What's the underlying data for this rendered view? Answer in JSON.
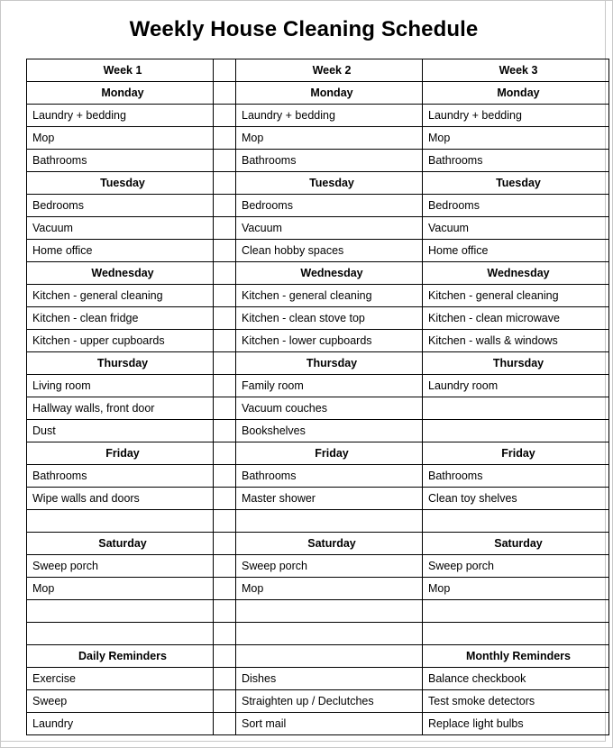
{
  "document": {
    "title": "Weekly House Cleaning Schedule"
  },
  "table": {
    "week_headers": [
      "Week 1",
      "Week 2",
      "Week 3"
    ],
    "sections": [
      {
        "day": [
          "Monday",
          "Monday",
          "Monday"
        ],
        "rows": [
          [
            "Laundry + bedding",
            "Laundry + bedding",
            "Laundry + bedding"
          ],
          [
            "Mop",
            "Mop",
            "Mop"
          ],
          [
            "Bathrooms",
            "Bathrooms",
            "Bathrooms"
          ]
        ]
      },
      {
        "day": [
          "Tuesday",
          "Tuesday",
          "Tuesday"
        ],
        "rows": [
          [
            "Bedrooms",
            "Bedrooms",
            "Bedrooms"
          ],
          [
            "Vacuum",
            "Vacuum",
            "Vacuum"
          ],
          [
            "Home office",
            "Clean hobby spaces",
            "Home office"
          ]
        ]
      },
      {
        "day": [
          "Wednesday",
          "Wednesday",
          "Wednesday"
        ],
        "rows": [
          [
            "Kitchen - general cleaning",
            "Kitchen - general cleaning",
            "Kitchen - general cleaning"
          ],
          [
            "Kitchen - clean fridge",
            "Kitchen - clean stove top",
            "Kitchen - clean microwave"
          ],
          [
            "Kitchen - upper cupboards",
            "Kitchen - lower cupboards",
            "Kitchen - walls & windows"
          ]
        ]
      },
      {
        "day": [
          "Thursday",
          "Thursday",
          "Thursday"
        ],
        "rows": [
          [
            "Living room",
            "Family room",
            "Laundry room"
          ],
          [
            "Hallway walls,  front door",
            "Vacuum couches",
            ""
          ],
          [
            "Dust",
            "Bookshelves",
            ""
          ]
        ]
      },
      {
        "day": [
          "Friday",
          "Friday",
          "Friday"
        ],
        "rows": [
          [
            "Bathrooms",
            "Bathrooms",
            "Bathrooms"
          ],
          [
            "Wipe walls and doors",
            "Master shower",
            "Clean toy shelves"
          ],
          [
            "",
            "",
            ""
          ]
        ]
      },
      {
        "day": [
          "Saturday",
          "Saturday",
          "Saturday"
        ],
        "rows": [
          [
            "Sweep porch",
            "Sweep porch",
            "Sweep porch"
          ],
          [
            "Mop",
            "Mop",
            "Mop"
          ],
          [
            "",
            "",
            ""
          ],
          [
            "",
            "",
            ""
          ]
        ]
      },
      {
        "day": [
          "Daily Reminders",
          "",
          "Monthly Reminders"
        ],
        "rows": [
          [
            "Exercise",
            "Dishes",
            "Balance checkbook"
          ],
          [
            "Sweep",
            "Straighten up / Declutches",
            "Test smoke detectors"
          ],
          [
            "Laundry",
            "Sort mail",
            "Replace light bulbs"
          ]
        ]
      }
    ]
  }
}
